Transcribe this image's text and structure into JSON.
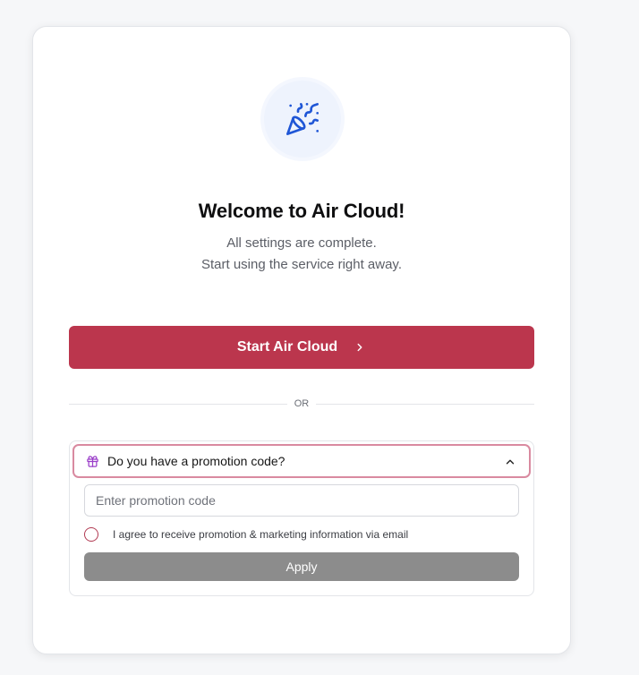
{
  "welcome": {
    "icon": "party-popper-icon",
    "title": "Welcome to Air Cloud!",
    "subtitle_line1": "All settings are complete.",
    "subtitle_line2": "Start using the service right away."
  },
  "start_button": {
    "label": "Start Air Cloud",
    "icon": "chevron-right-icon"
  },
  "divider": {
    "label": "OR"
  },
  "promotion": {
    "header_icon": "gift-icon",
    "header_label": "Do you have a promotion code?",
    "toggle_icon": "chevron-up-icon",
    "input_placeholder": "Enter promotion code",
    "input_value": "",
    "agree_label": "I agree to receive promotion & marketing information via email",
    "agree_checked": false,
    "apply_label": "Apply"
  },
  "colors": {
    "primary": "#bb364d",
    "accent_icon": "#1f56d6",
    "gift_icon": "#9b3fc9",
    "disabled_button": "#8c8c8c",
    "promo_focus_border": "#d98aa0"
  }
}
